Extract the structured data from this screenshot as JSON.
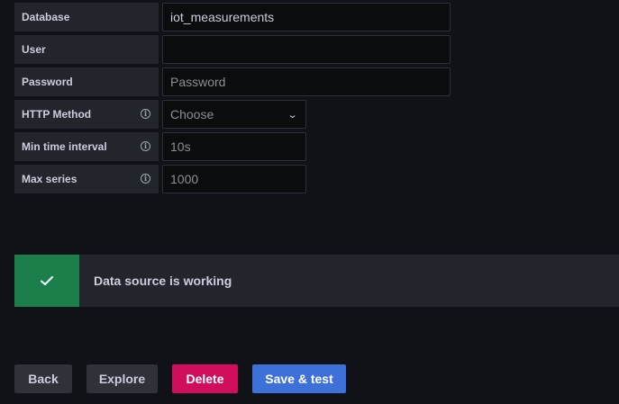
{
  "form": {
    "database": {
      "label": "Database",
      "value": "iot_measurements"
    },
    "user": {
      "label": "User",
      "value": ""
    },
    "password": {
      "label": "Password",
      "placeholder": "Password"
    },
    "http_method": {
      "label": "HTTP Method",
      "value": "Choose",
      "info_icon": "info-icon",
      "caret_icon": "chevron-down-icon"
    },
    "min_time_interval": {
      "label": "Min time interval",
      "placeholder": "10s",
      "info_icon": "info-icon"
    },
    "max_series": {
      "label": "Max series",
      "placeholder": "1000",
      "info_icon": "info-icon"
    }
  },
  "alert": {
    "text": "Data source is working",
    "icon": "check-icon",
    "color": "#1a7f4b"
  },
  "buttons": {
    "back": {
      "label": "Back",
      "color": "#2f3239"
    },
    "explore": {
      "label": "Explore",
      "color": "#2f3239"
    },
    "delete": {
      "label": "Delete",
      "color": "#d10e5c"
    },
    "save_test": {
      "label": "Save & test",
      "color": "#3d71d9"
    }
  }
}
